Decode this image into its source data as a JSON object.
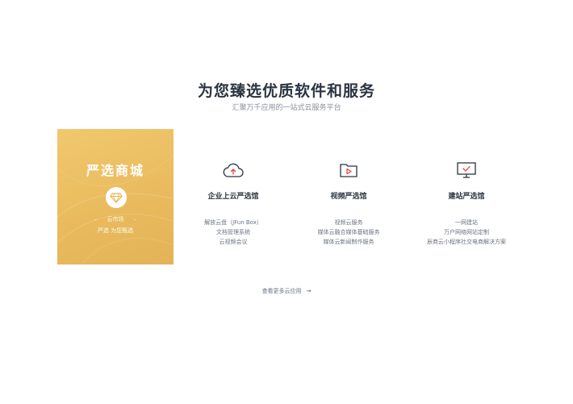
{
  "header": {
    "title": "为您臻选优质软件和服务",
    "subtitle": "汇聚万千应用的一站式云服务平台"
  },
  "promo": {
    "title": "严选商城",
    "line1": "云市场",
    "line2": "严选 为您甄选",
    "icon": "diamond-icon",
    "colors": {
      "start": "#f1c86e",
      "end": "#e3b457"
    }
  },
  "columns": [
    {
      "icon": "cloud-upload-icon",
      "name": "企业上云严选馆",
      "items": [
        "解放云盘（JFun Box）",
        "文档管理系统",
        "云视频会议"
      ]
    },
    {
      "icon": "video-folder-icon",
      "name": "视频严选馆",
      "items": [
        "视频云服务",
        "媒体云融合媒体基础服务",
        "媒体云新闻制作服务"
      ]
    },
    {
      "icon": "monitor-check-icon",
      "name": "建站严选馆",
      "items": [
        "一网建站",
        "万户网络网站定制",
        "辰商云小程序社交电商解决方案"
      ]
    }
  ],
  "more": {
    "label": "查看更多云应用",
    "arrow": "→"
  },
  "colors": {
    "accent": "#e0433a",
    "title": "#2b3441",
    "text": "#6b7380"
  }
}
